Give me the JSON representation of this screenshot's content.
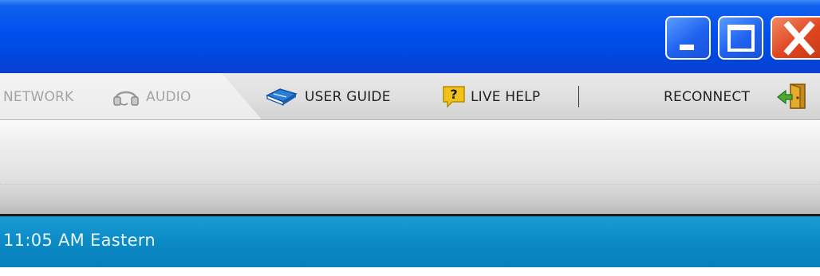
{
  "menu": {
    "network_label": "NETWORK",
    "audio_label": "AUDIO",
    "user_guide_label": "USER GUIDE",
    "live_help_label": "LIVE HELP",
    "reconnect_label": "RECONNECT"
  },
  "status": {
    "time_text": "11:05 AM Eastern"
  },
  "icons": {
    "audio": "headset-icon",
    "user_guide": "book-icon",
    "live_help": "question-icon",
    "reconnect": "door-exit-icon"
  },
  "colors": {
    "titlebar": "#0050ee",
    "close_button": "#e0451f",
    "status_bar": "#0b8ac6"
  }
}
